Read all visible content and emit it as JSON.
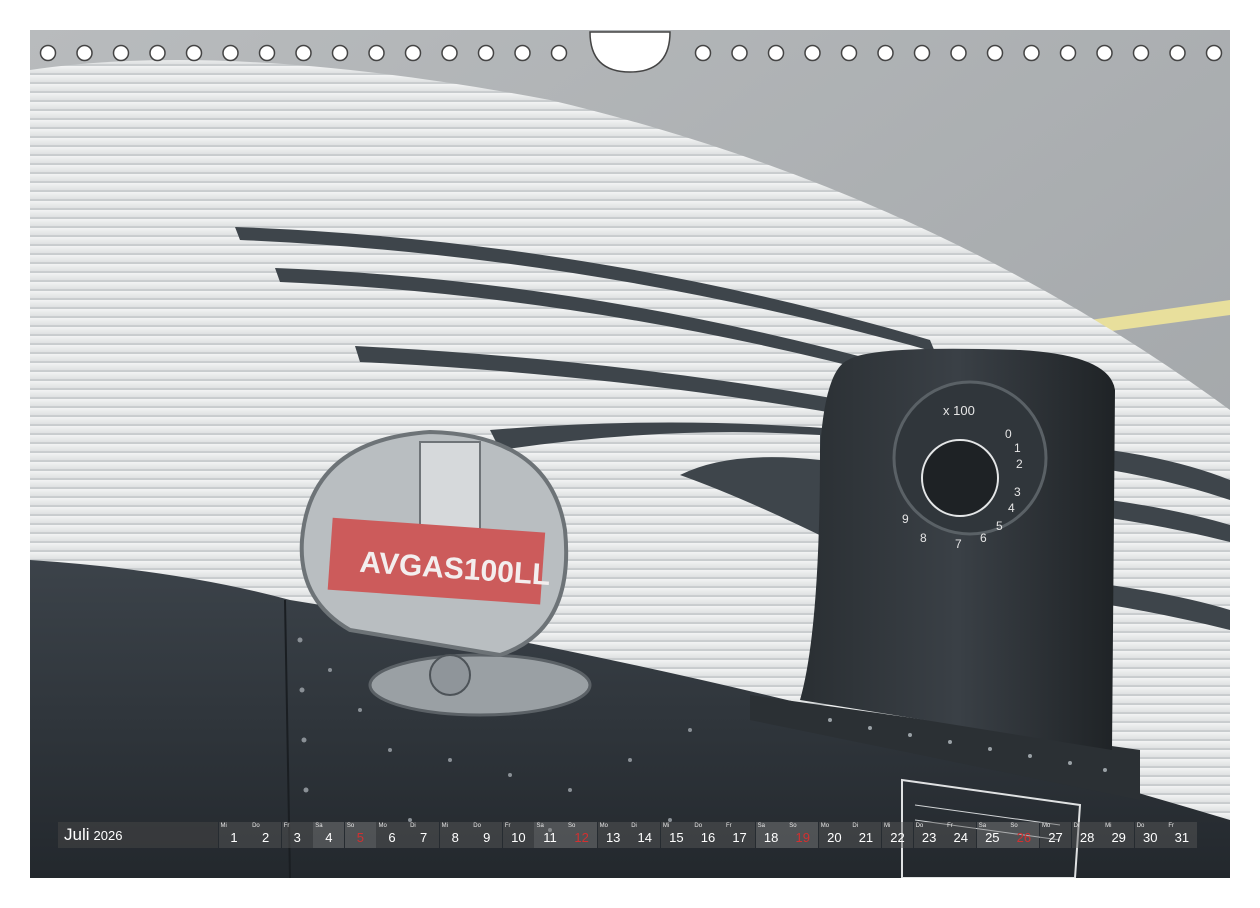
{
  "calendar": {
    "month": "Juli",
    "year": "2026",
    "colors": {
      "sunday": "#d23030",
      "strip": "#5a5a5a",
      "text": "#ffffff"
    },
    "days": [
      {
        "wd": "Mi",
        "num": "1",
        "sunday": false
      },
      {
        "wd": "Do",
        "num": "2",
        "sunday": false
      },
      {
        "wd": "Fr",
        "num": "3",
        "sunday": false
      },
      {
        "wd": "Sa",
        "num": "4",
        "sunday": false
      },
      {
        "wd": "So",
        "num": "5",
        "sunday": true
      },
      {
        "wd": "Mo",
        "num": "6",
        "sunday": false
      },
      {
        "wd": "Di",
        "num": "7",
        "sunday": false
      },
      {
        "wd": "Mi",
        "num": "8",
        "sunday": false
      },
      {
        "wd": "Do",
        "num": "9",
        "sunday": false
      },
      {
        "wd": "Fr",
        "num": "10",
        "sunday": false
      },
      {
        "wd": "Sa",
        "num": "11",
        "sunday": false
      },
      {
        "wd": "So",
        "num": "12",
        "sunday": true
      },
      {
        "wd": "Mo",
        "num": "13",
        "sunday": false
      },
      {
        "wd": "Di",
        "num": "14",
        "sunday": false
      },
      {
        "wd": "Mi",
        "num": "15",
        "sunday": false
      },
      {
        "wd": "Do",
        "num": "16",
        "sunday": false
      },
      {
        "wd": "Fr",
        "num": "17",
        "sunday": false
      },
      {
        "wd": "Sa",
        "num": "18",
        "sunday": false
      },
      {
        "wd": "So",
        "num": "19",
        "sunday": true
      },
      {
        "wd": "Mo",
        "num": "20",
        "sunday": false
      },
      {
        "wd": "Di",
        "num": "21",
        "sunday": false
      },
      {
        "wd": "Mi",
        "num": "22",
        "sunday": false
      },
      {
        "wd": "Do",
        "num": "23",
        "sunday": false
      },
      {
        "wd": "Fr",
        "num": "24",
        "sunday": false
      },
      {
        "wd": "Sa",
        "num": "25",
        "sunday": false
      },
      {
        "wd": "So",
        "num": "26",
        "sunday": true
      },
      {
        "wd": "Mo",
        "num": "27",
        "sunday": false
      },
      {
        "wd": "Di",
        "num": "28",
        "sunday": false
      },
      {
        "wd": "Mi",
        "num": "29",
        "sunday": false
      },
      {
        "wd": "Do",
        "num": "30",
        "sunday": false
      },
      {
        "wd": "Fr",
        "num": "31",
        "sunday": false
      }
    ]
  },
  "photo": {
    "fuel_cap_label": "AVGAS100LL",
    "gauge_label": "x 100",
    "gauge_digits": [
      "0",
      "1",
      "2",
      "3",
      "4",
      "5",
      "6",
      "7",
      "8",
      "9"
    ]
  }
}
